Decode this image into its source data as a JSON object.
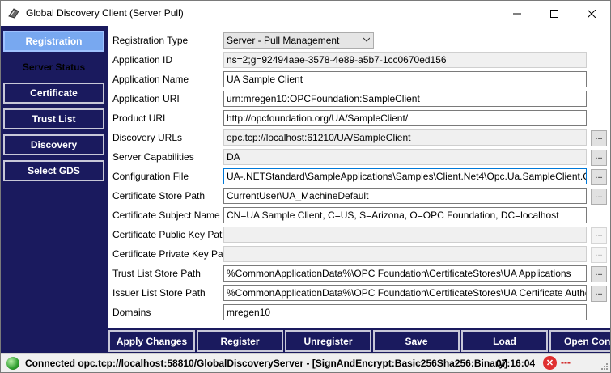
{
  "window": {
    "title": "Global Discovery Client (Server Pull)"
  },
  "nav": {
    "items": [
      {
        "label": "Registration"
      },
      {
        "label": "Server Status"
      },
      {
        "label": "Certificate"
      },
      {
        "label": "Trust List"
      },
      {
        "label": "Discovery"
      },
      {
        "label": "Select GDS"
      }
    ]
  },
  "form": {
    "registration_type": {
      "label": "Registration Type",
      "value": "Server - Pull Management"
    },
    "application_id": {
      "label": "Application ID",
      "value": "ns=2;g=92494aae-3578-4e89-a5b7-1cc0670ed156"
    },
    "application_name": {
      "label": "Application Name",
      "value": "UA Sample Client"
    },
    "application_uri": {
      "label": "Application URI",
      "value": "urn:mregen10:OPCFoundation:SampleClient"
    },
    "product_uri": {
      "label": "Product URI",
      "value": "http://opcfoundation.org/UA/SampleClient/"
    },
    "discovery_urls": {
      "label": "Discovery URLs",
      "value": "opc.tcp://localhost:61210/UA/SampleClient"
    },
    "server_capabilities": {
      "label": "Server Capabilities",
      "value": "DA"
    },
    "configuration_file": {
      "label": "Configuration File",
      "value": "UA-.NETStandard\\SampleApplications\\Samples\\Client.Net4\\Opc.Ua.SampleClient.Config.xml"
    },
    "certificate_store_path": {
      "label": "Certificate Store Path",
      "value": "CurrentUser\\UA_MachineDefault"
    },
    "certificate_subject_name": {
      "label": "Certificate Subject Name",
      "value": "CN=UA Sample Client, C=US, S=Arizona, O=OPC Foundation, DC=localhost"
    },
    "certificate_public_key_path": {
      "label": "Certificate Public Key Path",
      "value": ""
    },
    "certificate_private_key_path": {
      "label": "Certificate Private Key Path",
      "value": ""
    },
    "trust_list_store_path": {
      "label": "Trust List Store Path",
      "value": "%CommonApplicationData%\\OPC Foundation\\CertificateStores\\UA Applications"
    },
    "issuer_list_store_path": {
      "label": "Issuer List Store Path",
      "value": "%CommonApplicationData%\\OPC Foundation\\CertificateStores\\UA Certificate Authorities"
    },
    "domains": {
      "label": "Domains",
      "value": "mregen10"
    },
    "browse_label": "..."
  },
  "actions": {
    "apply_changes": "Apply Changes",
    "register": "Register",
    "unregister": "Unregister",
    "save": "Save",
    "load": "Load",
    "open_config": "Open Con"
  },
  "status": {
    "connection": "Connected opc.tcp://localhost:58810/GlobalDiscoveryServer - [SignAndEncrypt:Basic256Sha256:Binary]",
    "time": "07:16:04",
    "dashes": "---"
  },
  "colors": {
    "nav_bg": "#1a1a5e",
    "nav_active": "#78a8f0",
    "status_connected": "#2e9e2e",
    "status_error": "#e03030"
  }
}
